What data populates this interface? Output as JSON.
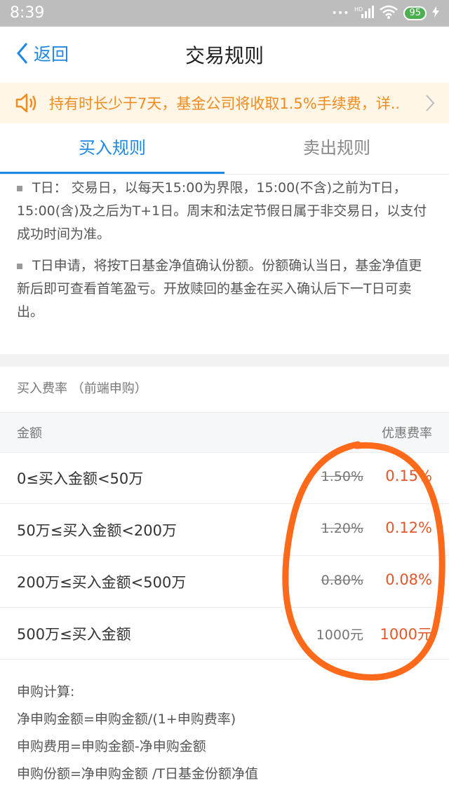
{
  "status_bar": {
    "time": "8:39",
    "signal_label": "HD",
    "battery": "95"
  },
  "nav": {
    "back_label": "返回",
    "title": "交易规则"
  },
  "notice": {
    "text": "持有时长少于7天，基金公司将收取1.5%手续费，详.."
  },
  "tabs": [
    {
      "label": "买入规则",
      "active": true
    },
    {
      "label": "卖出规则",
      "active": false
    }
  ],
  "rules": [
    "T日： 交易日，以每天15:00为界限，15:00(不含)之前为T日，15:00(含)及之后为T+1日。周末和法定节假日属于非交易日，以支付成功时间为准。",
    "T日申请，将按T日基金净值确认份额。份额确认当日，基金净值更新后即可查看首笔盈亏。开放赎回的基金在买入确认后下一T日可卖出。"
  ],
  "fee_section": {
    "title": "买入费率 （前端申购）",
    "header_amount": "金额",
    "header_discount": "优惠费率",
    "rows": [
      {
        "range": "0≤买入金额<50万",
        "original": "1.50%",
        "discount": "0.15%",
        "strike": true
      },
      {
        "range": "50万≤买入金额<200万",
        "original": "1.20%",
        "discount": "0.12%",
        "strike": true
      },
      {
        "range": "200万≤买入金额<500万",
        "original": "0.80%",
        "discount": "0.08%",
        "strike": true
      },
      {
        "range": "500万≤买入金额",
        "original": "1000元",
        "discount": "1000元",
        "strike": false
      }
    ]
  },
  "calc": {
    "title": "申购计算:",
    "lines": [
      "净申购金额=申购金额/(1+申购费率)",
      "申购费用=申购金额-净申购金额",
      "申购份额=净申购金额 /T日基金份额净值"
    ]
  },
  "colors": {
    "accent": "#1e88e5",
    "notice": "#f08b1e",
    "discount": "#e2572b",
    "annotation": "#ff6a1a"
  },
  "icons": {
    "back": "chevron-left-icon",
    "speaker": "speaker-icon",
    "notice_more": "chevron-right-icon"
  }
}
